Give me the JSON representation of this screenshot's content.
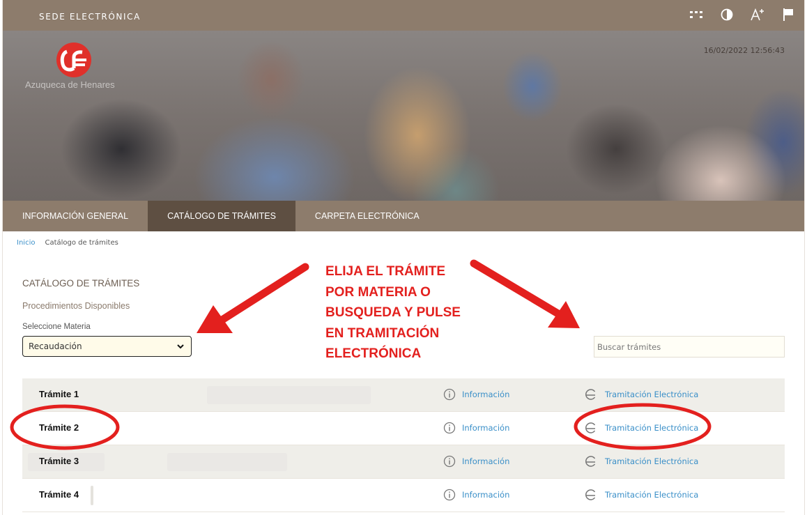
{
  "header": {
    "site_label": "SEDE ELECTRÓNICA",
    "tools": [
      "grid-icon",
      "contrast-icon",
      "text-size-icon",
      "flag-icon"
    ]
  },
  "banner": {
    "logo_text": "Azuqueca de Henares",
    "datetime": "16/02/2022 12:56:43"
  },
  "nav": {
    "items": [
      {
        "label": "INFORMACIÓN GENERAL",
        "active": false
      },
      {
        "label": "CATÁLOGO DE TRÁMITES",
        "active": true
      },
      {
        "label": "CARPETA ELECTRÓNICA",
        "active": false
      }
    ]
  },
  "breadcrumb": {
    "home": "Inicio",
    "current": "Catálogo de trámites"
  },
  "catalog": {
    "title": "CATÁLOGO DE TRÁMITES",
    "subtitle": "Procedimientos Disponibles",
    "select_label": "Seleccione Materia",
    "select_value": "Recaudación",
    "search_placeholder": "Buscar trámites"
  },
  "annotation": {
    "lines": [
      "ELIJA EL TRÁMITE",
      "POR MATERIA O",
      "BUSQUEDA Y PULSE",
      "EN TRAMITACIÓN",
      "ELECTRÓNICA"
    ],
    "color": "#e3201e"
  },
  "rows": [
    {
      "name": "Trámite 1",
      "info": "Información",
      "tram": "Tramitación Electrónica"
    },
    {
      "name": "Trámite 2",
      "info": "Información",
      "tram": "Tramitación Electrónica"
    },
    {
      "name": "Trámite 3",
      "info": "Información",
      "tram": "Tramitación Electrónica"
    },
    {
      "name": "Trámite 4",
      "info": "Información",
      "tram": "Tramitación Electrónica"
    }
  ],
  "colors": {
    "brand_brown": "#8d7c6c",
    "nav_active": "#5e4f42",
    "link_blue": "#3a8fc8",
    "logo_red": "#e0302a"
  }
}
